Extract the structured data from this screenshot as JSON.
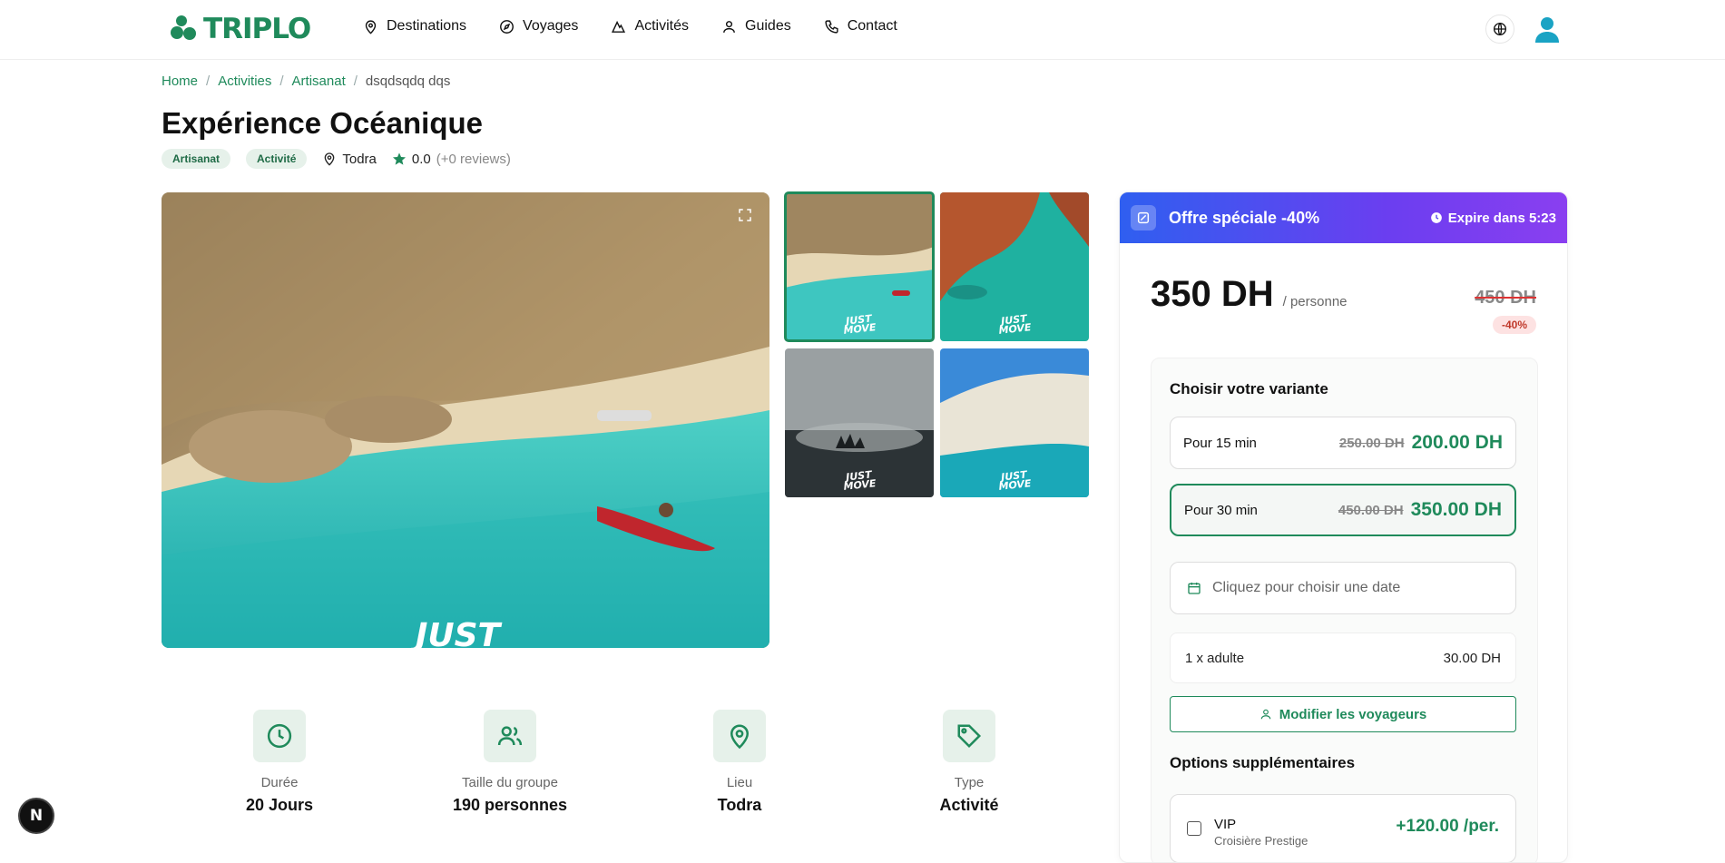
{
  "brand": {
    "name": "TRIPLO",
    "color": "#1f8a5b"
  },
  "nav": {
    "items": [
      {
        "label": "Destinations",
        "icon": "map-pin-icon"
      },
      {
        "label": "Voyages",
        "icon": "compass-icon"
      },
      {
        "label": "Activités",
        "icon": "mountain-icon"
      },
      {
        "label": "Guides",
        "icon": "user-icon"
      },
      {
        "label": "Contact",
        "icon": "phone-icon"
      }
    ]
  },
  "breadcrumb": {
    "home": "Home",
    "activities": "Activities",
    "category": "Artisanat",
    "current": "dsqdsqdq dqs",
    "sep": "/"
  },
  "page": {
    "title": "Expérience Océanique",
    "tags": [
      "Artisanat",
      "Activité"
    ],
    "location": "Todra",
    "rating": "0.0",
    "reviews": "(+0 reviews)"
  },
  "gallery": {
    "watermark_top": "JUST",
    "watermark_bottom": "MOVE"
  },
  "features": [
    {
      "label": "Durée",
      "value": "20 Jours",
      "icon": "clock-icon"
    },
    {
      "label": "Taille du groupe",
      "value": "190 personnes",
      "icon": "users-icon"
    },
    {
      "label": "Lieu",
      "value": "Todra",
      "icon": "map-pin-icon"
    },
    {
      "label": "Type",
      "value": "Activité",
      "icon": "tag-icon"
    }
  ],
  "booking": {
    "promo_title": "Offre spéciale -40%",
    "promo_timer": "Expire dans 5:23",
    "price": "350 DH",
    "per": "/ personne",
    "old_price": "450 DH",
    "discount": "-40%",
    "variants_title": "Choisir votre variante",
    "variants": [
      {
        "label": "Pour 15 min",
        "old": "250.00 DH",
        "price": "200.00 DH",
        "selected": false
      },
      {
        "label": "Pour 30 min",
        "old": "450.00 DH",
        "price": "350.00 DH",
        "selected": true
      }
    ],
    "date_placeholder": "Cliquez pour choisir une date",
    "traveler_label": "1 x adulte",
    "traveler_price": "30.00 DH",
    "modify_label": "Modifier les voyageurs",
    "options_title": "Options supplémentaires",
    "option": {
      "name": "VIP",
      "sub": "Croisière Prestige",
      "price": "+120.00 /per."
    }
  },
  "dev_badge": "N"
}
